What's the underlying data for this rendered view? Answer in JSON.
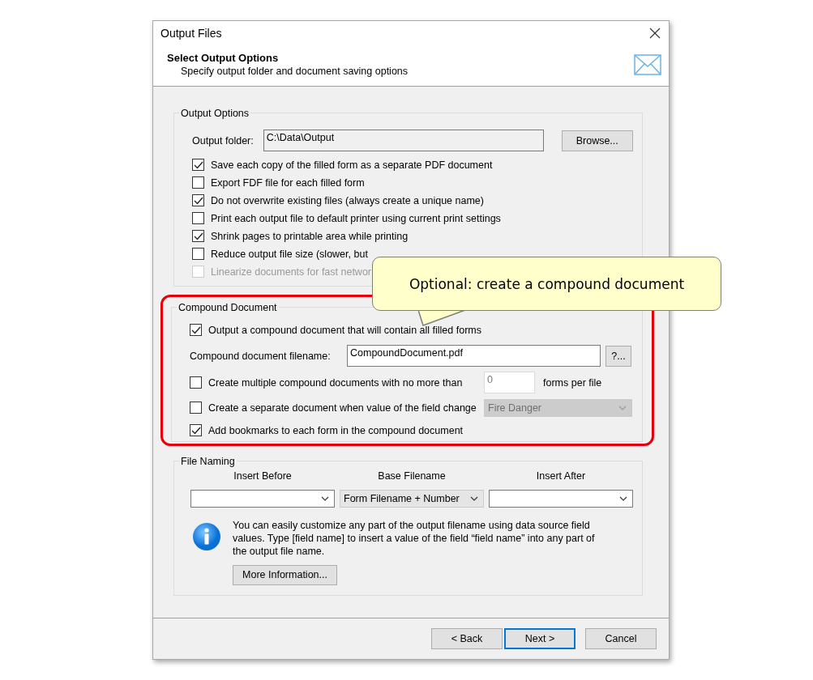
{
  "window": {
    "title": "Output Files"
  },
  "header": {
    "title": "Select Output Options",
    "subtitle": "Specify output folder and document saving options"
  },
  "output_options": {
    "legend": "Output Options",
    "folder_label": "Output folder:",
    "folder_value": "C:\\Data\\Output",
    "browse": "Browse...",
    "checkboxes": [
      {
        "label": "Save each copy of the filled form as a separate PDF document",
        "checked": true,
        "disabled": false
      },
      {
        "label": "Export FDF file for each filled form",
        "checked": false,
        "disabled": false
      },
      {
        "label": "Do not overwrite existing files (always create a unique name)",
        "checked": true,
        "disabled": false
      },
      {
        "label": "Print each output file to default printer using current print settings",
        "checked": false,
        "disabled": false
      },
      {
        "label": "Shrink pages to printable area while printing",
        "checked": true,
        "disabled": false
      },
      {
        "label": "Reduce output file size  (slower, but",
        "checked": false,
        "disabled": false
      },
      {
        "label": "Linearize documents for fast networ",
        "checked": false,
        "disabled": true
      }
    ]
  },
  "compound": {
    "legend": "Compound Document",
    "rows": [
      {
        "kind": "checkbox",
        "label": "Output a compound document that will contain all filled forms",
        "checked": true
      },
      {
        "kind": "filename",
        "label": "Compound document filename:",
        "value": "CompoundDocument.pdf",
        "button": "?..."
      },
      {
        "kind": "count",
        "label": "Create multiple compound documents with no more than",
        "checked": false,
        "value": "0",
        "suffix": "forms per file",
        "disabled": true
      },
      {
        "kind": "select",
        "label": "Create a separate document when value of the field change",
        "checked": false,
        "value": "Fire Danger",
        "disabled": true
      },
      {
        "kind": "checkbox",
        "label": "Add bookmarks to each form in the compound document",
        "checked": true
      }
    ]
  },
  "file_naming": {
    "legend": "File Naming",
    "columns": [
      {
        "heading": "Insert Before",
        "readonly": false
      },
      {
        "heading": "Base Filename",
        "value": "Form Filename + Number",
        "readonly": true
      },
      {
        "heading": "Insert After",
        "readonly": false
      }
    ],
    "info": "You can easily customize any part of the output filename using data source field values. Type [field name] to insert a value of the field “field name” into any part of the output file name.",
    "more": "More Information..."
  },
  "buttons": [
    {
      "label": "< Back",
      "default": false
    },
    {
      "label": "Next >",
      "default": true
    },
    {
      "label": "Cancel",
      "default": false
    }
  ],
  "callout": {
    "text": "Optional: create a compound document"
  }
}
